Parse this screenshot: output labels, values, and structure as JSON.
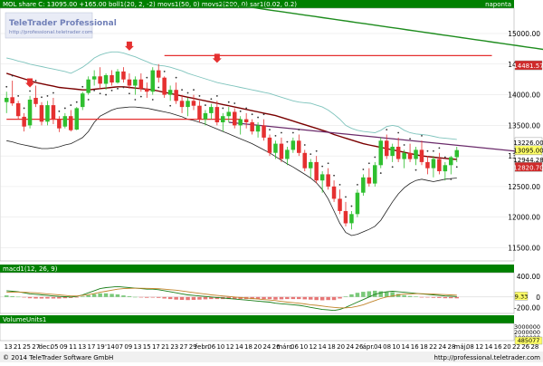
{
  "chart_data": {
    "type": "candlestick",
    "header": {
      "title": "MOL share C: 13095.00 +165.00 boll1(20, 2, -2) movs1(50, 0) movs2(200, 0) sar1(0.02, 0.2)",
      "right_label": "naponta"
    },
    "watermark": {
      "brand": "TeleTrader Professional",
      "url": "http://professional.teletrader.com"
    },
    "price_axis": {
      "ylim": [
        11300,
        15400
      ],
      "ticks": [
        11500,
        12000,
        12500,
        13000,
        13500,
        14000,
        14500,
        15000
      ],
      "tick_labels": [
        "11500.00",
        "12000.00",
        "12500.00",
        "13000.00",
        "13500.00",
        "14000.00",
        "14500.00",
        "15000.00"
      ],
      "tags": [
        {
          "label": "14481.57",
          "value": 14481.57,
          "color": "#cf2a2a",
          "text_color": "#ffffff"
        },
        {
          "label": "13226.00",
          "value": 13226.0,
          "color": "#ffffff",
          "text_color": "#000000"
        },
        {
          "label": "13095.00",
          "value": 13095.0,
          "color": "#ffff66",
          "text_color": "#000000"
        },
        {
          "label": "12944.28",
          "value": 12944.28,
          "color": "#ffffff",
          "text_color": "#000000"
        },
        {
          "label": "12820.70",
          "value": 12820.7,
          "color": "#cf2a2a",
          "text_color": "#ffffff"
        }
      ]
    },
    "candles": [
      [
        13880,
        14050,
        13700,
        13950
      ],
      [
        13960,
        14230,
        13820,
        13860
      ],
      [
        13860,
        13900,
        13600,
        13650
      ],
      [
        13640,
        13700,
        13400,
        13480
      ],
      [
        13500,
        13980,
        13450,
        13920
      ],
      [
        13950,
        14150,
        13800,
        13850
      ],
      [
        13830,
        13880,
        13500,
        13560
      ],
      [
        13560,
        13900,
        13500,
        13830
      ],
      [
        13830,
        13950,
        13520,
        13600
      ],
      [
        13600,
        13650,
        13390,
        13450
      ],
      [
        13480,
        13700,
        13450,
        13650
      ],
      [
        13650,
        13750,
        13400,
        13420
      ],
      [
        13430,
        13800,
        13420,
        13780
      ],
      [
        13800,
        14050,
        13750,
        14020
      ],
      [
        14030,
        14300,
        14000,
        14250
      ],
      [
        14250,
        14400,
        14150,
        14300
      ],
      [
        14300,
        14450,
        14100,
        14180
      ],
      [
        14180,
        14350,
        14080,
        14320
      ],
      [
        14320,
        14400,
        14150,
        14200
      ],
      [
        14200,
        14420,
        14180,
        14380
      ],
      [
        14380,
        14450,
        14200,
        14250
      ],
      [
        14250,
        14350,
        14100,
        14150
      ],
      [
        14150,
        14300,
        14000,
        14250
      ],
      [
        14250,
        14350,
        14050,
        14100
      ],
      [
        14100,
        14200,
        13950,
        14050
      ],
      [
        14050,
        14450,
        14000,
        14400
      ],
      [
        14400,
        14500,
        14200,
        14280
      ],
      [
        14280,
        14300,
        13950,
        14000
      ],
      [
        14000,
        14150,
        13900,
        14080
      ],
      [
        14080,
        14200,
        13850,
        13900
      ],
      [
        13900,
        14000,
        13700,
        13800
      ],
      [
        13800,
        13950,
        13650,
        13900
      ],
      [
        13900,
        14000,
        13750,
        13820
      ],
      [
        13820,
        13900,
        13550,
        13600
      ],
      [
        13600,
        13750,
        13500,
        13700
      ],
      [
        13700,
        13850,
        13600,
        13800
      ],
      [
        13800,
        13900,
        13500,
        13550
      ],
      [
        13550,
        13700,
        13400,
        13650
      ],
      [
        13650,
        13800,
        13550,
        13720
      ],
      [
        13720,
        13780,
        13450,
        13500
      ],
      [
        13500,
        13650,
        13350,
        13600
      ],
      [
        13600,
        13700,
        13450,
        13550
      ],
      [
        13550,
        13600,
        13350,
        13400
      ],
      [
        13400,
        13550,
        13300,
        13500
      ],
      [
        13500,
        13600,
        13250,
        13300
      ],
      [
        13300,
        13350,
        13000,
        13050
      ],
      [
        13050,
        13250,
        12950,
        13200
      ],
      [
        13200,
        13300,
        12900,
        12950
      ],
      [
        12950,
        13150,
        12850,
        13100
      ],
      [
        13100,
        13300,
        13050,
        13250
      ],
      [
        13250,
        13350,
        13000,
        13050
      ],
      [
        13050,
        13100,
        12750,
        12800
      ],
      [
        12800,
        12950,
        12650,
        12900
      ],
      [
        12900,
        13000,
        12550,
        12600
      ],
      [
        12600,
        12750,
        12400,
        12700
      ],
      [
        12700,
        12800,
        12450,
        12500
      ],
      [
        12500,
        12600,
        12250,
        12300
      ],
      [
        12300,
        12450,
        12050,
        12100
      ],
      [
        12100,
        12250,
        11850,
        11900
      ],
      [
        11900,
        12100,
        11800,
        12050
      ],
      [
        12050,
        12450,
        12000,
        12400
      ],
      [
        12400,
        12700,
        12350,
        12650
      ],
      [
        12650,
        12800,
        12500,
        12550
      ],
      [
        12550,
        12900,
        12500,
        12850
      ],
      [
        12850,
        13300,
        12800,
        13250
      ],
      [
        13250,
        13350,
        12950,
        13000
      ],
      [
        13000,
        13200,
        12900,
        13150
      ],
      [
        13150,
        13300,
        12900,
        12950
      ],
      [
        12950,
        13100,
        12800,
        13050
      ],
      [
        13050,
        13200,
        12900,
        12950
      ],
      [
        12950,
        13150,
        12850,
        13100
      ],
      [
        13100,
        13250,
        12850,
        12900
      ],
      [
        12900,
        13000,
        12700,
        12800
      ],
      [
        12800,
        13000,
        12650,
        12950
      ],
      [
        12950,
        13050,
        12700,
        12750
      ],
      [
        12750,
        12900,
        12600,
        12850
      ],
      [
        12850,
        13000,
        12700,
        12980
      ],
      [
        12980,
        13150,
        12900,
        13095
      ]
    ],
    "bollinger_upper": [
      14600,
      14580,
      14550,
      14530,
      14500,
      14480,
      14460,
      14440,
      14420,
      14400,
      14380,
      14350,
      14400,
      14450,
      14520,
      14600,
      14650,
      14680,
      14700,
      14700,
      14680,
      14650,
      14620,
      14580,
      14540,
      14500,
      14480,
      14470,
      14450,
      14420,
      14390,
      14350,
      14320,
      14290,
      14260,
      14230,
      14200,
      14180,
      14160,
      14140,
      14120,
      14100,
      14080,
      14060,
      14040,
      14020,
      13990,
      13960,
      13930,
      13900,
      13880,
      13870,
      13860,
      13830,
      13800,
      13750,
      13680,
      13600,
      13500,
      13450,
      13420,
      13400,
      13390,
      13380,
      13420,
      13480,
      13500,
      13480,
      13420,
      13380,
      13360,
      13350,
      13340,
      13320,
      13300,
      13290,
      13280,
      13270
    ],
    "bollinger_lower": [
      13250,
      13230,
      13200,
      13180,
      13160,
      13140,
      13120,
      13120,
      13130,
      13150,
      13180,
      13200,
      13250,
      13300,
      13400,
      13550,
      13650,
      13700,
      13750,
      13780,
      13790,
      13800,
      13800,
      13790,
      13780,
      13760,
      13740,
      13720,
      13700,
      13670,
      13640,
      13600,
      13580,
      13550,
      13520,
      13480,
      13440,
      13400,
      13360,
      13320,
      13280,
      13240,
      13200,
      13150,
      13100,
      13050,
      12990,
      12930,
      12870,
      12820,
      12760,
      12700,
      12640,
      12560,
      12450,
      12300,
      12100,
      11900,
      11750,
      11700,
      11720,
      11760,
      11800,
      11850,
      11950,
      12100,
      12250,
      12380,
      12480,
      12550,
      12600,
      12620,
      12600,
      12580,
      12600,
      12620,
      12630,
      12640
    ],
    "sma50": [
      14350,
      14320,
      14290,
      14260,
      14230,
      14200,
      14180,
      14160,
      14140,
      14120,
      14110,
      14100,
      14090,
      14080,
      14080,
      14090,
      14100,
      14110,
      14120,
      14130,
      14130,
      14120,
      14110,
      14100,
      14090,
      14080,
      14060,
      14040,
      14020,
      14000,
      13980,
      13960,
      13940,
      13920,
      13900,
      13880,
      13860,
      13840,
      13820,
      13800,
      13780,
      13760,
      13740,
      13720,
      13700,
      13680,
      13660,
      13630,
      13600,
      13570,
      13540,
      13510,
      13480,
      13450,
      13420,
      13390,
      13350,
      13320,
      13290,
      13260,
      13230,
      13200,
      13180,
      13160,
      13140,
      13120,
      13100,
      13080,
      13060,
      13040,
      13020,
      13000,
      12990,
      12980,
      12970,
      12960,
      12950,
      12945
    ],
    "sma200": [
      15500,
      15480,
      15460,
      15440,
      15420,
      15400,
      15380,
      15360,
      15340,
      15320,
      15300,
      15280,
      15260,
      15240,
      15220,
      15200,
      15180,
      15160,
      15140,
      15120,
      15100,
      15080,
      15060,
      15040,
      15020,
      15000,
      14980,
      14960,
      14940,
      14920,
      14900,
      14880,
      14860,
      14840,
      14820,
      14800,
      14780,
      14760,
      14740,
      14720,
      14700,
      14680,
      14660,
      14640,
      14620,
      14600,
      14580,
      14560,
      14540,
      14520,
      14500,
      14482
    ],
    "trend_lines": [
      {
        "from": [
          0,
          13600
        ],
        "to": [
          40,
          13600
        ],
        "color": "#e53030"
      },
      {
        "from": [
          27,
          14640
        ],
        "to": [
          83,
          14640
        ],
        "color": "#e53030"
      },
      {
        "from": [
          38,
          13550
        ],
        "to": [
          89,
          13060
        ],
        "color": "#6a2a6a"
      }
    ],
    "arrows": [
      {
        "i": 4,
        "value": 14150
      },
      {
        "i": 21,
        "value": 14750
      },
      {
        "i": 36,
        "value": 14550
      }
    ],
    "x_axis_labels": [
      "13",
      "21",
      "25",
      "27",
      "dec.",
      "05",
      "09",
      "11",
      "13",
      "17",
      "19",
      "'14",
      "07",
      "09",
      "13",
      "15",
      "17",
      "21",
      "23",
      "27",
      "29",
      "febr.",
      "06",
      "10",
      "12",
      "14",
      "18",
      "20",
      "24",
      "26",
      "márc.",
      "06",
      "10",
      "12",
      "14",
      "18",
      "20",
      "24",
      "26",
      "ápr.",
      "04",
      "08",
      "10",
      "14",
      "16",
      "18",
      "22",
      "24",
      "28",
      "máj.",
      "08",
      "12",
      "14",
      "16",
      "20",
      "22",
      "26",
      "28"
    ],
    "macd": {
      "label": "macd1(12, 26, 9)",
      "ylim": [
        -300,
        450
      ],
      "ticks": [
        400,
        0,
        -200
      ],
      "tick_labels": [
        "400.00",
        "0",
        "-200.00"
      ],
      "tag": "9.33",
      "macd_line": [
        120,
        110,
        100,
        80,
        60,
        50,
        40,
        30,
        20,
        10,
        5,
        0,
        10,
        40,
        80,
        120,
        160,
        180,
        190,
        200,
        190,
        180,
        170,
        160,
        150,
        150,
        140,
        120,
        100,
        80,
        60,
        40,
        30,
        20,
        10,
        0,
        -10,
        -20,
        -30,
        -40,
        -50,
        -60,
        -70,
        -80,
        -90,
        -100,
        -120,
        -130,
        -140,
        -150,
        -160,
        -180,
        -200,
        -220,
        -240,
        -250,
        -260,
        -240,
        -200,
        -150,
        -100,
        -50,
        0,
        50,
        80,
        100,
        110,
        100,
        90,
        80,
        70,
        60,
        50,
        40,
        30,
        20,
        15,
        9
      ],
      "signal_line": [
        90,
        95,
        95,
        90,
        85,
        80,
        70,
        60,
        50,
        40,
        30,
        20,
        20,
        30,
        45,
        65,
        90,
        110,
        130,
        150,
        160,
        165,
        168,
        168,
        165,
        162,
        158,
        150,
        140,
        130,
        115,
        100,
        85,
        70,
        55,
        40,
        30,
        20,
        10,
        0,
        -10,
        -20,
        -30,
        -40,
        -50,
        -60,
        -70,
        -85,
        -100,
        -110,
        -120,
        -135,
        -150,
        -160,
        -175,
        -190,
        -200,
        -210,
        -210,
        -200,
        -180,
        -150,
        -110,
        -70,
        -30,
        0,
        20,
        40,
        55,
        60,
        62,
        62,
        60,
        55,
        50,
        45,
        40,
        35
      ]
    },
    "volume": {
      "label": "VolumeUnits1",
      "ticks": [
        3000000,
        2000000,
        1000000
      ],
      "tick_labels": [
        "3000000",
        "2000000",
        "1000000"
      ],
      "tag": "485077"
    },
    "footer": {
      "copyright": "© 2014 TeleTrader Software GmbH",
      "url": "http://professional.teletrader.com"
    }
  }
}
